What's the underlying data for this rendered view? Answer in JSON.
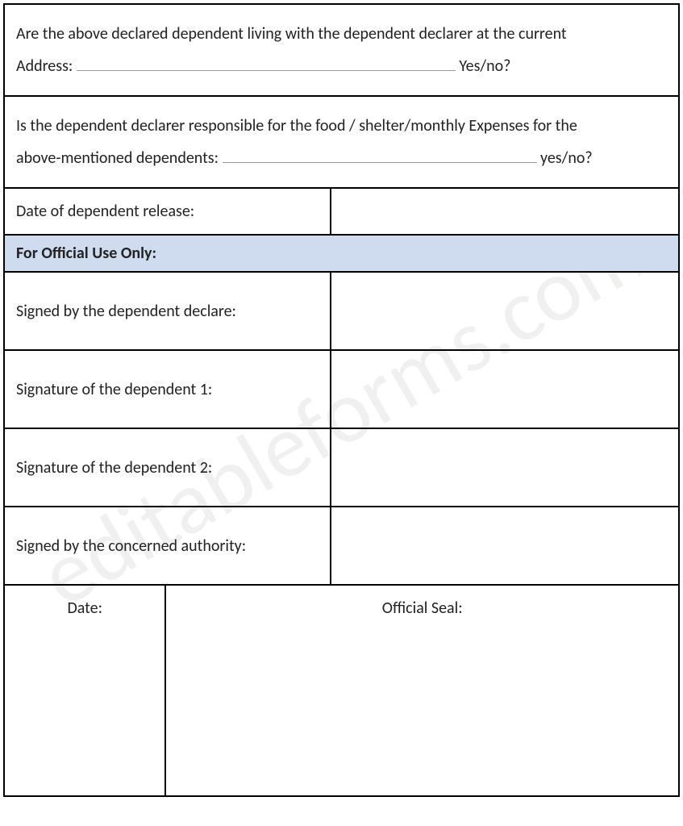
{
  "watermark": "editableforms.com",
  "q1": {
    "line1": "Are the above declared dependent living with the dependent declarer at the current",
    "addressLabel": "Address:",
    "suffix": "Yes/no?"
  },
  "q2": {
    "line1": "Is the dependent declarer responsible for the food / shelter/monthly Expenses for the",
    "label": "above-mentioned dependents:",
    "suffix": "yes/no?"
  },
  "dateRelease": "Date of dependent release:",
  "officialHeader": "For Official Use Only:",
  "rows": {
    "signedDeclare": "Signed by the dependent declare:",
    "sigDep1": "Signature of the dependent 1:",
    "sigDep2": "Signature of the dependent 2:",
    "signedAuthority": "Signed by the concerned authority:"
  },
  "bottom": {
    "date": "Date:",
    "seal": "Official Seal:"
  }
}
